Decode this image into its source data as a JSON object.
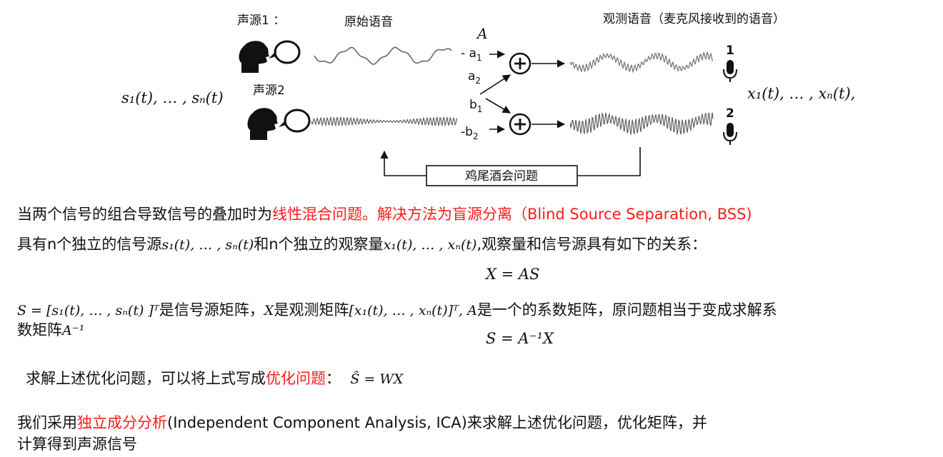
{
  "diagram": {
    "source1_label": "声源1 ：",
    "source2_label": "声源2",
    "original_label": "原始语音",
    "observed_label": "观测语音（麦克风接收到的语音）",
    "matrix_symbol": "A",
    "coef_a1": "- a",
    "coef_a2": "a",
    "coef_b1": "b",
    "coef_b2": "-b",
    "sub1": "1",
    "sub2": "2",
    "mic1_num": "1",
    "mic2_num": "2",
    "plus": "+",
    "sources_expr": "s₁(t), … , sₙ(t)",
    "observed_expr": "x₁(t), … , xₙ(t),",
    "cocktail_label": "鸡尾酒会问题"
  },
  "text": {
    "l1_a": "当两个信号的组合导致信号的叠加时为",
    "l1_red": "线性混合问题。解决方法为盲源分离（Blind Source Separation, BSS)",
    "l2_a": "具有n个独立的信号源",
    "l2_m1": "s₁(t), … , sₙ(t)",
    "l2_b": "和n个独立的观察量",
    "l2_m2": "x₁(t), … , xₙ(t)",
    "l2_c": ",观察量和信号源具有如下的关系：",
    "eq1": "X = AS",
    "l3_m1": "S = [s₁(t), … , sₙ(t) ]ᵀ",
    "l3_a": "是信号源矩阵，",
    "l3_m2": "X",
    "l3_b": "是观测矩阵",
    "l3_m3": "[x₁(t), … , xₙ(t)]ᵀ, A",
    "l3_c": "是一个的系数矩阵，原问题相当于变成求解系",
    "l4_a": "数矩阵",
    "l4_m": "A⁻¹",
    "eq2": "S = A⁻¹X",
    "l5_a": "求解上述优化问题，可以将上式写成",
    "l5_red": "优化问题",
    "l5_b": "：",
    "l5_m": "Ŝ = WX",
    "l6_a": "我们采用",
    "l6_red": "独立成分分析",
    "l6_b": "(Independent Component Analysis, ICA)来求解上述优化问题，优化矩阵，并",
    "l7": "计算得到声源信号"
  }
}
